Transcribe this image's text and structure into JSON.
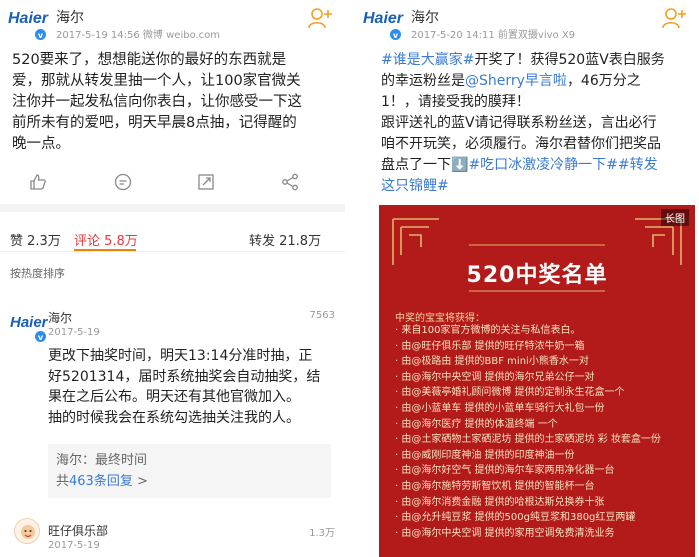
{
  "left": {
    "author": "海尔",
    "logo_text": "Haier",
    "verify_badge": "v",
    "meta": "2017-5-19 14:56  微博 weibo.com",
    "post_lines": [
      "520要来了，想想能送你的最好的东西就是",
      "爱，那就从转发里抽一个人，让100家官微关",
      "注你并一起发私信向你表白，让你感受一下这",
      "前所未有的爱吧，明天早晨8点抽，记得醒的",
      "晚一点。"
    ],
    "action_icons": [
      "thumb-up-icon",
      "comment-icon",
      "edit-icon",
      "share-icon"
    ],
    "tabs": {
      "like": "赞 2.3万",
      "comment": "评论 5.8万",
      "repost": "转发 21.8万"
    },
    "sort_label": "按热度排序",
    "comments": [
      {
        "logo_text": "Haier",
        "name": "海尔",
        "date": "2017-5-19",
        "likes": "7563",
        "lines": [
          "更改下抽奖时间，明天13:14分准时抽，正",
          "好5201314，届时系统抽奖会自动抽奖，结",
          "果在之后公布。明天还有其他官微加入。",
          "抽的时候我会在系统勾选抽关注我的人。"
        ],
        "reply_preview": "海尔：最终时间",
        "reply_count_prefix": "共",
        "reply_count_num": "463条回复",
        "reply_count_suffix": " >"
      },
      {
        "name": "旺仔俱乐部",
        "date": "2017-5-19",
        "likes": "1.3万"
      }
    ]
  },
  "right": {
    "author": "海尔",
    "logo_text": "Haier",
    "verify_badge": "v",
    "meta": "2017-5-20 14:11  前置双摄vivo X9",
    "post": {
      "l1_tag1": "#谁是大赢家#",
      "l1_tail": "开奖了！获得520蓝V表白服务",
      "l2_head": "的幸运粉丝是",
      "l2_at": "@Sherry早言啦",
      "l2_tail": "，46万分之",
      "l3": "1！，请接受我的膜拜！",
      "l4": "跟评送礼的蓝V请记得联系粉丝送，言出必行",
      "l5": "咱不开玩笑，必须履行。海尔君替你们把奖品",
      "l6_head": "盘点了一下⬇️",
      "l6_tag": "#吃口冰激凌冷静一下##转发",
      "l7_tag": "这只锦鲤#"
    },
    "poster": {
      "badge": "长图",
      "title": "520中奖名单",
      "intro": "中奖的宝宝将获得：",
      "items": [
        "· 来自100家官方微博的关注与私信表白。",
        "· 由@旺仔俱乐部 提供的旺仔特浓牛奶一箱",
        "· 由@极路由 提供的BBF mini小熊香水一对",
        "· 由@海尔中央空调 提供的海尔兄弟公仔一对",
        "· 由@美薇亭婚礼顾问微博 提供的定制永生花盒一个",
        "· 由@小蓝单车 提供的小蓝单车骑行大礼包一份",
        "· 由@海尔医疗 提供的体温终端 一个",
        "· 由@土家硒物土家硒泥坊 提供的土家硒泥坊 彩 妆套盒一份",
        "· 由@威刚印度神油 提供的印度神油一份",
        "· 由@海尔好空气 提供的海尔车家两用净化器一台",
        "· 由@海尔施特劳斯智饮机 提供的智能杯一台",
        "· 由@海尔消费金融 提供的哈根达斯兑换券十张",
        "· 由@允升纯豆浆 提供的500g纯豆浆和380g红豆两罐",
        "· 由@海尔中央空调 提供的家用空调免费清洗业务"
      ]
    }
  },
  "colors": {
    "brand_blue": "#1a5fb4",
    "link_blue": "#3a7bd5",
    "active_tab": "#e4393c",
    "poster_red": "#b31b1b",
    "poster_gold": "#f7d6a0"
  }
}
